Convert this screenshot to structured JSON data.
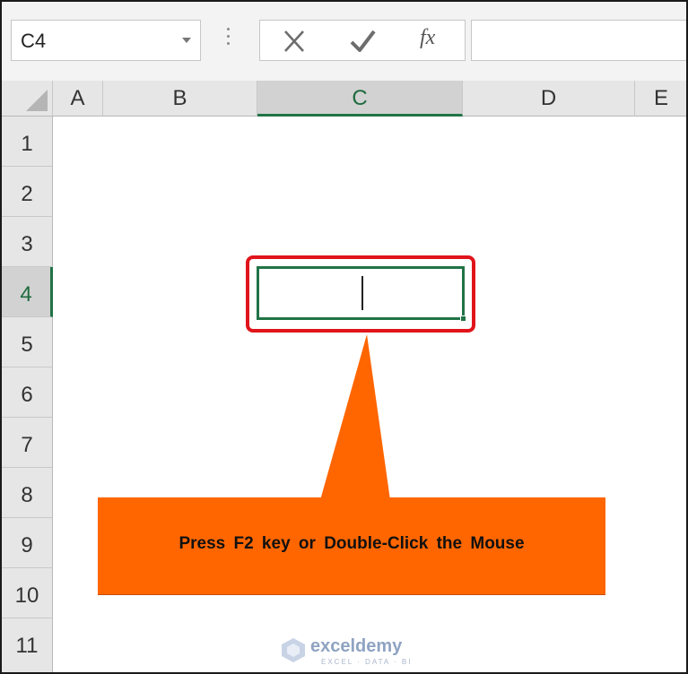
{
  "formula_bar": {
    "name_box_value": "C4",
    "fx_label": "fx",
    "formula_value": ""
  },
  "columns": [
    "A",
    "B",
    "C",
    "D",
    "E"
  ],
  "rows": [
    "1",
    "2",
    "3",
    "4",
    "5",
    "6",
    "7",
    "8",
    "9",
    "10",
    "11"
  ],
  "active_cell": {
    "column": "C",
    "row": "4"
  },
  "callout": {
    "text": "Press F2 key or Double-Click the Mouse"
  },
  "watermark": {
    "name": "exceldemy",
    "tagline": "EXCEL · DATA · BI"
  },
  "colors": {
    "accent_green": "#217346",
    "highlight_red": "#e0151b",
    "callout_orange": "#ff6600"
  },
  "icons": [
    "cancel-icon",
    "enter-icon",
    "insert-function-icon",
    "name-box-dropdown-icon",
    "select-all-icon"
  ]
}
